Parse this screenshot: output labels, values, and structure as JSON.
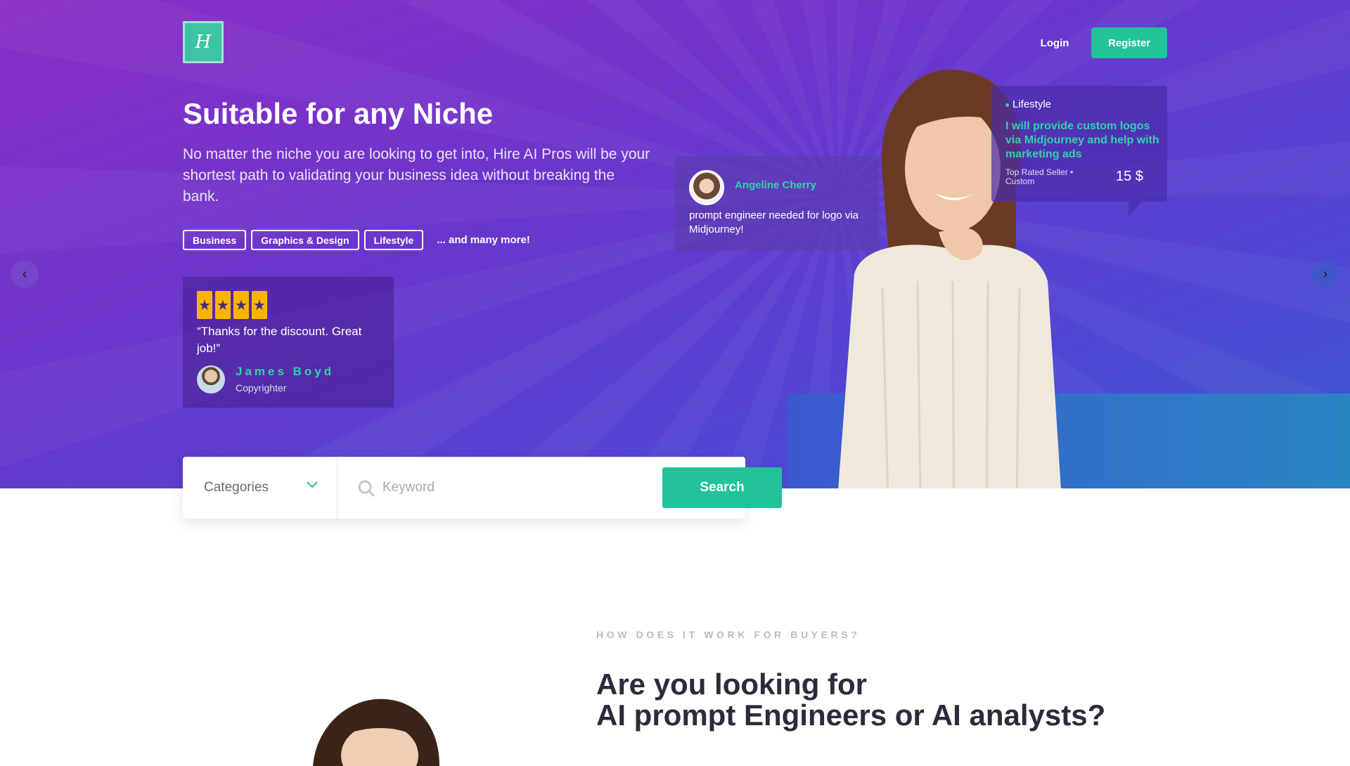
{
  "header": {
    "logo_letter": "H",
    "login_label": "Login",
    "register_label": "Register"
  },
  "hero": {
    "title": "Suitable for any Niche",
    "description": "No matter the niche you are looking to get into, Hire AI Pros will be your shortest path to validating your business idea without breaking the bank.",
    "tags": [
      "Business",
      "Graphics & Design",
      "Lifestyle"
    ],
    "more_label": "... and many more!"
  },
  "testimonial": {
    "stars": 4,
    "quote": "“Thanks for the discount. Great job!”",
    "name": "James Boyd",
    "role": "Copyrighter"
  },
  "prompt_card": {
    "name": "Angeline Cherry",
    "text": "prompt engineer needed for logo via Midjourney!"
  },
  "offer_card": {
    "category": "Lifestyle",
    "title": "I will provide custom logos via Midjourney and help with marketing ads",
    "seller": "Top Rated Seller • Custom",
    "price": "15 $"
  },
  "search": {
    "category_label": "Categories",
    "keyword_placeholder": "Keyword",
    "button_label": "Search"
  },
  "how": {
    "label": "HOW DOES IT WORK FOR BUYERS?",
    "title_line1": "Are you looking for",
    "title_line2": "AI prompt Engineers or AI analysts?"
  },
  "icons": {
    "carousel_prev": "chevron-left-icon",
    "carousel_next": "chevron-right-icon",
    "search": "search-icon",
    "dropdown": "chevron-down-icon",
    "star": "star-icon"
  },
  "colors": {
    "accent": "#22c29a",
    "highlight_text": "#2ed3a8",
    "star": "#f7b500",
    "hero_gradient_start": "#8a2dc4",
    "hero_gradient_end": "#3a5ad0"
  }
}
